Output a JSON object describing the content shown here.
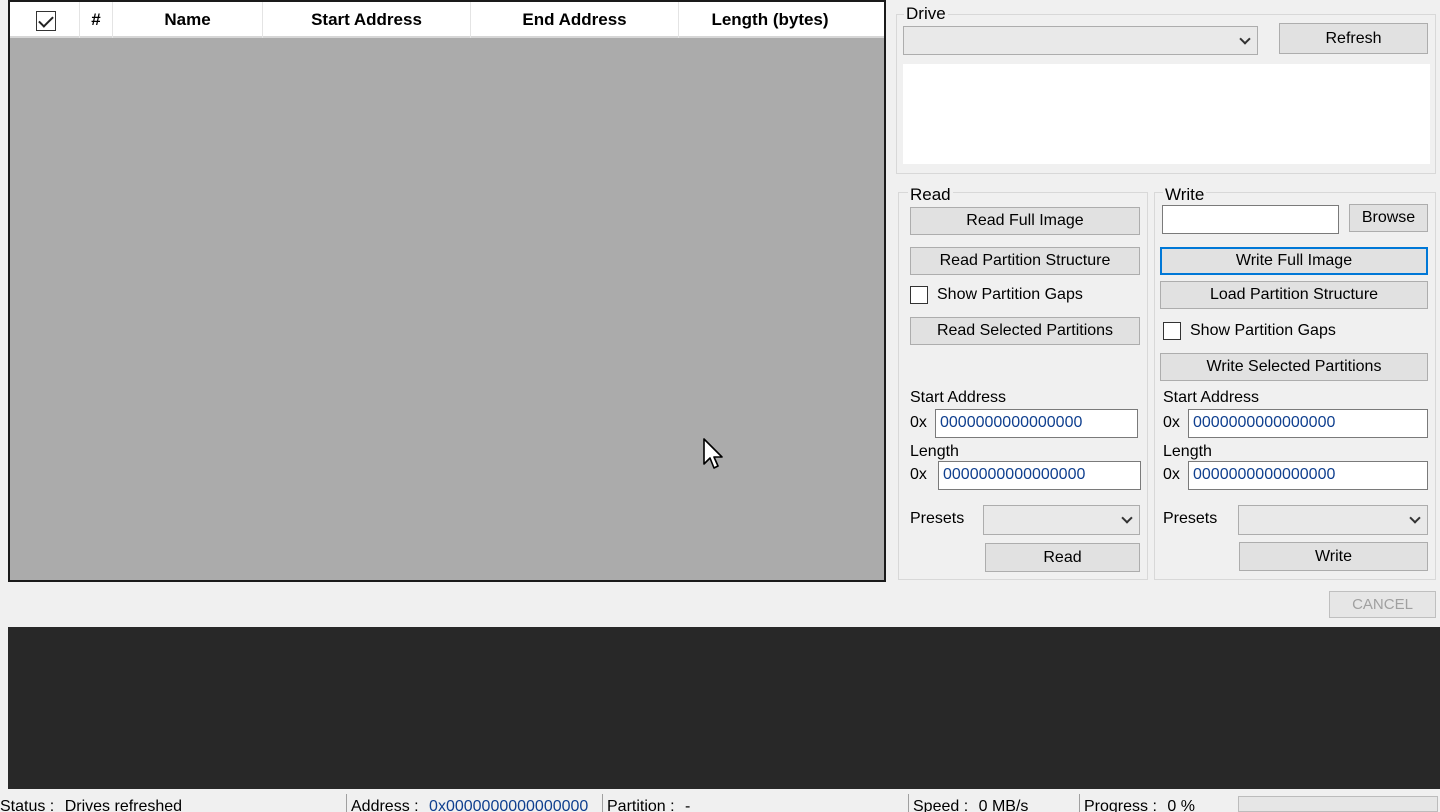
{
  "table": {
    "columns": [
      "#",
      "Name",
      "Start Address",
      "End Address",
      "Length (bytes)"
    ],
    "select_all_checked": true
  },
  "drive": {
    "label": "Drive",
    "selected": "",
    "refresh_label": "Refresh"
  },
  "read": {
    "label": "Read",
    "read_full_image": "Read Full Image",
    "read_partition_structure": "Read Partition Structure",
    "show_partition_gaps": "Show Partition Gaps",
    "read_selected_partitions": "Read Selected Partitions",
    "start_address_label": "Start Address",
    "hex_prefix": "0x",
    "start_address_value": "0000000000000000",
    "length_label": "Length",
    "length_value": "0000000000000000",
    "presets_label": "Presets",
    "presets_selected": "",
    "read_button": "Read"
  },
  "write": {
    "label": "Write",
    "file_path": "",
    "browse_label": "Browse",
    "write_full_image": "Write Full Image",
    "load_partition_structure": "Load Partition Structure",
    "show_partition_gaps": "Show Partition Gaps",
    "write_selected_partitions": "Write Selected Partitions",
    "start_address_label": "Start Address",
    "hex_prefix": "0x",
    "start_address_value": "0000000000000000",
    "length_label": "Length",
    "length_value": "0000000000000000",
    "presets_label": "Presets",
    "presets_selected": "",
    "write_button": "Write"
  },
  "cancel_label": "CANCEL",
  "status_bar": {
    "status_label": "Status :",
    "status_value": "Drives refreshed",
    "address_label": "Address :",
    "address_value": "0x0000000000000000",
    "partition_label": "Partition :",
    "partition_value": "-",
    "speed_label": "Speed :",
    "speed_value": "0 MB/s",
    "progress_label": "Progress :",
    "progress_value": "0 %",
    "progress_fraction": 0
  },
  "colors": {
    "console_bg": "#282828",
    "table_bg": "#ababab",
    "focus_border": "#0078d7",
    "hex_text": "#0f3f8f"
  }
}
